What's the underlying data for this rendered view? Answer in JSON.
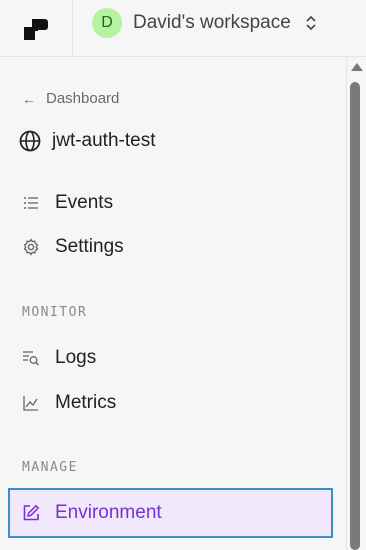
{
  "workspace": {
    "avatar_initial": "D",
    "name": "David's workspace"
  },
  "nav": {
    "back_label": "Dashboard",
    "project_name": "jwt-auth-test",
    "items_top": [
      {
        "label": "Events",
        "icon": "list-icon"
      },
      {
        "label": "Settings",
        "icon": "gear-icon"
      }
    ],
    "monitor_label": "MONITOR",
    "monitor_items": [
      {
        "label": "Logs",
        "icon": "logs-search-icon"
      },
      {
        "label": "Metrics",
        "icon": "chart-line-icon"
      }
    ],
    "manage_label": "MANAGE",
    "manage_items": [
      {
        "label": "Environment",
        "icon": "edit-square-icon",
        "active": true
      }
    ]
  },
  "colors": {
    "active_text": "#7b2fd6",
    "active_bg": "#f1e9fb",
    "active_border": "#3a8fc7",
    "avatar_bg": "#b6f2a0"
  }
}
